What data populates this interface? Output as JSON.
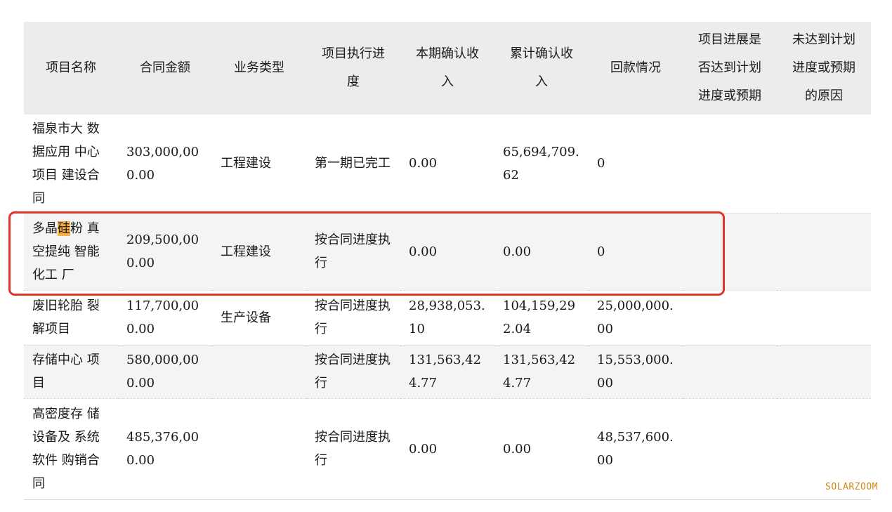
{
  "table": {
    "headers": [
      "项目名称",
      "合同金额",
      "业务类型",
      "项目执行进度",
      "本期确认收入",
      "累计确认收入",
      "回款情况",
      "项目进展是否达到计划进度或预期",
      "未达到计划进度或预期的原因"
    ],
    "rows": [
      {
        "name": "福泉市大 数据应用 中心项目 建设合同",
        "amount": "303,000,000.00",
        "type": "工程建设",
        "progress": "第一期已完工",
        "current_income": "0.00",
        "cumulative_income": "65,694,709.62",
        "collection": "0",
        "on_track": "",
        "reason": ""
      },
      {
        "name_before": "多晶",
        "name_highlight": "硅",
        "name_after": "粉 真空提纯 智能化工 厂",
        "amount": "209,500,000.00",
        "type": "工程建设",
        "progress": "按合同进度执行",
        "current_income": "0.00",
        "cumulative_income": "0.00",
        "collection": "0",
        "on_track": "",
        "reason": ""
      },
      {
        "name": "废旧轮胎 裂解项目",
        "amount": "117,700,000.00",
        "type": "生产设备",
        "progress": "按合同进度执行",
        "current_income": "28,938,053.10",
        "cumulative_income": "104,159,292.04",
        "collection": "25,000,000.00",
        "on_track": "",
        "reason": ""
      },
      {
        "name": "存储中心 项目",
        "amount": "580,000,000.00",
        "type": "",
        "progress": "按合同进度执行",
        "current_income": "131,563,424.77",
        "cumulative_income": "131,563,424.77",
        "collection": "15,553,000.00",
        "on_track": "",
        "reason": ""
      },
      {
        "name": "高密度存 储设备及 系统软件 购销合同",
        "amount": "485,376,000.00",
        "type": "",
        "progress": "按合同进度执行",
        "current_income": "0.00",
        "cumulative_income": "0.00",
        "collection": "48,537,600.00",
        "on_track": "",
        "reason": ""
      }
    ]
  },
  "watermark": "SOLARZOOM",
  "colors": {
    "header_bg": "#ececec",
    "stripe_bg": "#f4f4f4",
    "highlight": "#f5b043",
    "annotation_box": "#e0342a",
    "watermark": "#d18a1a"
  }
}
